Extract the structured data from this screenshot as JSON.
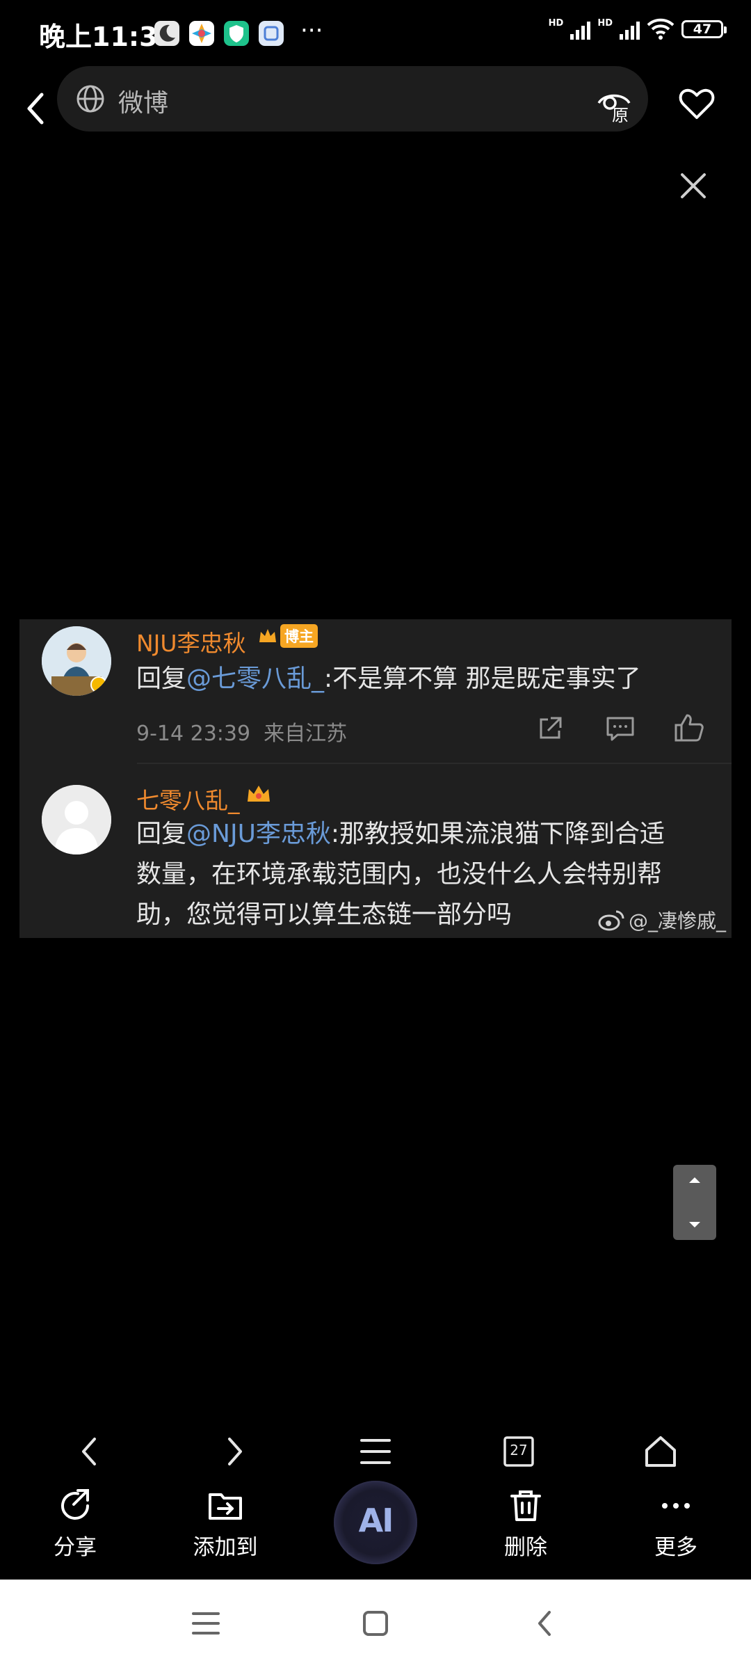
{
  "status_bar": {
    "time": "晚上11:32",
    "network_labels": [
      "HD",
      "HD"
    ],
    "battery": "47"
  },
  "top_bar": {
    "search_text": "微博",
    "original_label": "原"
  },
  "comments": [
    {
      "username": "NJU李忠秋",
      "badge": "博主",
      "reply_prefix": "回复",
      "mention": "@七零八乱_",
      "text": ":不是算不算 那是既定事实了",
      "timestamp": "9-14 23:39",
      "location": "来自江苏"
    },
    {
      "username": "七零八乱_",
      "reply_prefix": "回复",
      "mention": "@NJU李忠秋",
      "text_line1": ":那教授如果流浪猫下降到合适",
      "text_line2": "数量，在环境承载范围内，也没什么人会特别帮",
      "text_line3": "助，您觉得可以算生态链一部分吗",
      "watermark": "@_凄惨戚_"
    }
  ],
  "browser_nav": {
    "tabs_count": "27"
  },
  "actions": {
    "share": "分享",
    "add_to": "添加到",
    "ai": "AI",
    "delete": "删除",
    "more": "更多"
  },
  "colors": {
    "background": "#000000",
    "card": "#1f1f1f",
    "username": "#f08a2e",
    "mention": "#6a9bd8",
    "meta": "#8b8b8b",
    "system_nav": "#ffffff"
  }
}
